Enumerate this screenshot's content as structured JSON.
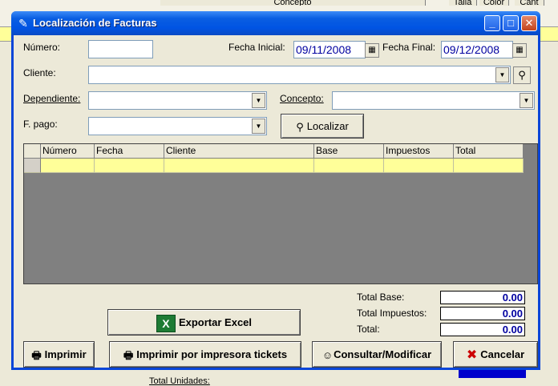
{
  "background": {
    "header_cols": [
      "Concepto",
      "Talla",
      "Color",
      "Cant"
    ],
    "bottom_label": "Total Unidades:"
  },
  "window": {
    "title": "Localización de Facturas",
    "controls": {
      "minimize": "_",
      "maximize": "□",
      "close": "✕"
    }
  },
  "form": {
    "numero_label": "Número:",
    "numero_value": "",
    "fecha_inicial_label": "Fecha Inicial:",
    "fecha_inicial_value": "09/11/2008",
    "fecha_final_label": "Fecha Final:",
    "fecha_final_value": "09/12/2008",
    "cliente_label": "Cliente:",
    "cliente_value": "",
    "dependiente_label": "Dependiente:",
    "dependiente_value": "",
    "concepto_label": "Concepto:",
    "concepto_value": "",
    "fpago_label": "F. pago:",
    "fpago_value": "",
    "localizar_label": "Localizar"
  },
  "grid": {
    "columns": [
      "Número",
      "Fecha",
      "Cliente",
      "Base",
      "Impuestos",
      "Total"
    ],
    "rows": [
      [
        "",
        "",
        "",
        "",
        "",
        ""
      ]
    ]
  },
  "totals": {
    "base_label": "Total Base:",
    "base_value": "0.00",
    "impuestos_label": "Total Impuestos:",
    "impuestos_value": "0.00",
    "total_label": "Total:",
    "total_value": "0.00"
  },
  "buttons": {
    "exportar_excel": "Exportar Excel",
    "imprimir": "Imprimir",
    "imprimir_tickets": "Imprimir por impresora tickets",
    "consultar": "Consultar/Modificar",
    "cancelar": "Cancelar"
  },
  "icons": {
    "window": "invoice-icon",
    "calendar": "calendar-icon",
    "search": "search-icon",
    "excel": "excel-icon",
    "printer": "printer-icon",
    "consult": "smiley-icon",
    "cancel": "red-x-icon"
  },
  "colors": {
    "titlebar": "#0054e3",
    "grid_row": "#ffff99",
    "value_text": "#0000a0",
    "cancel_x": "#cc0000"
  }
}
